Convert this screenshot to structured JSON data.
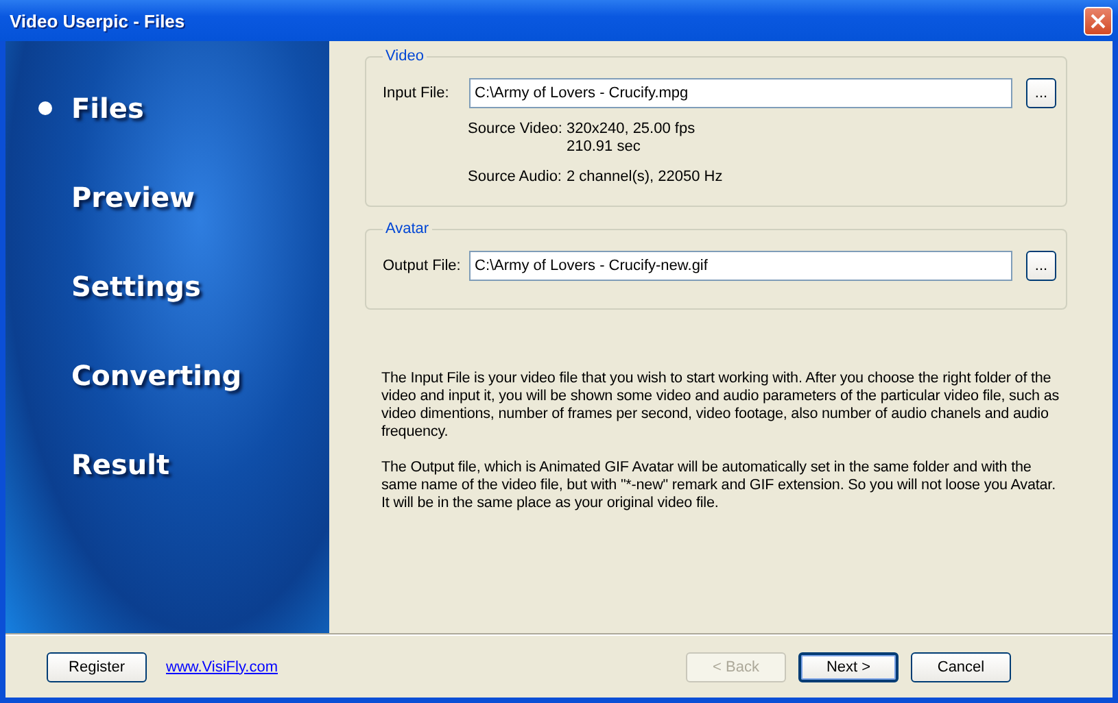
{
  "window": {
    "title": "Video Userpic - Files"
  },
  "steps": [
    {
      "label": "Files",
      "selected": true
    },
    {
      "label": "Preview",
      "selected": false
    },
    {
      "label": "Settings",
      "selected": false
    },
    {
      "label": "Converting",
      "selected": false
    },
    {
      "label": "Result",
      "selected": false
    }
  ],
  "video_group": {
    "title": "Video",
    "input_label": "Input File:",
    "input_value": "C:\\Army of Lovers - Crucify.mpg",
    "browse": "...",
    "info": [
      {
        "label": "Source Video:",
        "lines": [
          "320x240, 25.00 fps",
          "210.91 sec"
        ]
      },
      {
        "label": "Source Audio:",
        "lines": [
          "2 channel(s), 22050 Hz"
        ]
      }
    ]
  },
  "avatar_group": {
    "title": "Avatar",
    "output_label": "Output File:",
    "output_value": "C:\\Army of Lovers - Crucify-new.gif",
    "browse": "..."
  },
  "help": [
    "The Input File is your video file that you wish to start working with. After you choose the right folder of the video and input it, you will be shown some video and audio parameters of the particular video file, such as video dimentions, number of frames per second, video footage, also number of audio chanels and audio frequency.",
    "The Output file, which is Animated GIF Avatar will be automatically set in the same folder and with the same name of the video file, but with \"*-new\" remark and GIF extension. So you will not loose you Avatar. It will be in the same place as your original video file."
  ],
  "footer": {
    "register": "Register",
    "link": "www.VisiFly.com",
    "buttons": [
      {
        "label": "< Back",
        "disabled": true,
        "default": false
      },
      {
        "label": "Next >",
        "disabled": false,
        "default": true
      },
      {
        "label": "Cancel",
        "disabled": false,
        "default": false
      }
    ]
  }
}
